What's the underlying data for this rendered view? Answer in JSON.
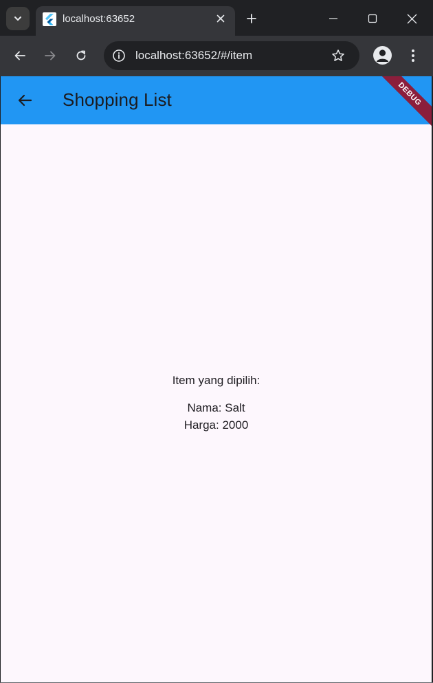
{
  "browser": {
    "tab_title": "localhost:63652",
    "url": "localhost:63652/#/item"
  },
  "app": {
    "title": "Shopping List",
    "debug_label": "DEBUG",
    "appbar_color": "#2196f3",
    "background_color": "#fdf7fd"
  },
  "content": {
    "heading": "Item yang dipilih:",
    "name_line": "Nama: Salt",
    "price_line": "Harga: 2000"
  }
}
